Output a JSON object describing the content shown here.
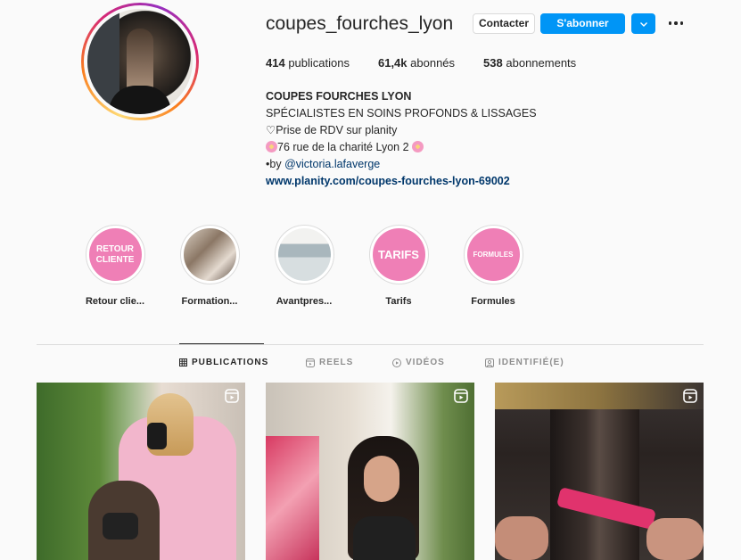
{
  "profile": {
    "username": "coupes_fourches_lyon",
    "contact_label": "Contacter",
    "follow_label": "S'abonner"
  },
  "stats": {
    "posts_count": "414",
    "posts_label": "publications",
    "followers_count": "61,4k",
    "followers_label": "abonnés",
    "following_count": "538",
    "following_label": "abonnements"
  },
  "bio": {
    "name": "COUPES FOURCHES LYON",
    "line1": "SPÉCIALISTES EN SOINS PROFONDS & LISSAGES",
    "line2": "♡Prise de RDV sur planity",
    "line3": "76 rue de la charité Lyon 2",
    "line4_prefix": "•by",
    "line4_mention": "@victoria.lafaverge",
    "website": "www.planity.com/coupes-fourches-lyon-69002"
  },
  "highlights": [
    {
      "label": "Retour clie...",
      "cover_text": "RETOUR CLIENTE"
    },
    {
      "label": "Formation..."
    },
    {
      "label": "Avantpres..."
    },
    {
      "label": "Tarifs",
      "cover_text": "TARIFS"
    },
    {
      "label": "Formules",
      "cover_text": "FORMULES"
    }
  ],
  "tabs": [
    {
      "label": "PUBLICATIONS",
      "icon": "grid-icon",
      "active": true
    },
    {
      "label": "REELS",
      "icon": "reels-icon",
      "active": false
    },
    {
      "label": "VIDÉOS",
      "icon": "video-icon",
      "active": false
    },
    {
      "label": "IDENTIFIÉ(E)",
      "icon": "tagged-icon",
      "active": false
    }
  ],
  "posts": [
    {
      "type": "reel",
      "icon": "reel-icon"
    },
    {
      "type": "reel",
      "icon": "reel-icon"
    },
    {
      "type": "reel",
      "icon": "reel-icon"
    }
  ],
  "colors": {
    "accent": "#0095f6",
    "highlight_pink": "#ef7fb6",
    "link": "#00376b"
  }
}
